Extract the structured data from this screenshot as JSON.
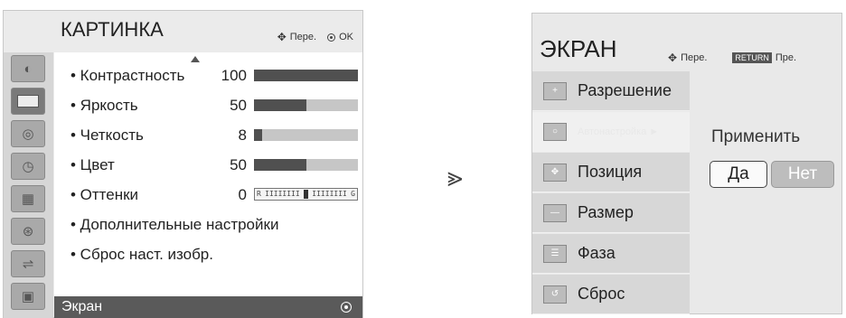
{
  "picture_menu": {
    "title": "КАРТИНКА",
    "hint_move": "Пере.",
    "hint_ok": "OK",
    "sidebar_icons": [
      "disc-icon",
      "screen-icon",
      "audio-icon",
      "clock-icon",
      "lock-icon",
      "option-icon",
      "input-icon",
      "usb-icon"
    ],
    "items": [
      {
        "label": "• Контрастность",
        "value": "100",
        "level": 1.0
      },
      {
        "label": "• Яркость",
        "value": "50",
        "level": 0.5
      },
      {
        "label": "• Четкость",
        "value": "8",
        "level": 0.08
      },
      {
        "label": "• Цвет",
        "value": "50",
        "level": 0.5
      },
      {
        "label": "• Оттенки",
        "value": "0",
        "tint_left": "R",
        "tint_right": "G"
      },
      {
        "label": "• Дополнительные настройки"
      },
      {
        "label": "• Сброс наст. изобр."
      }
    ],
    "footer": "Экран"
  },
  "transition_arrow": "⪢",
  "screen_menu": {
    "title": "ЭКРАН",
    "hint_move": "Пере.",
    "return_chip": "RETURN",
    "hint_back": "Пре.",
    "items": [
      {
        "label": "Разрешение",
        "icon": "plus-icon"
      },
      {
        "label": "Автонастройка ►",
        "icon": "auto-icon",
        "selected": true
      },
      {
        "label": "Позиция",
        "icon": "position-icon"
      },
      {
        "label": "Размер",
        "icon": "size-icon"
      },
      {
        "label": "Фаза",
        "icon": "phase-icon"
      },
      {
        "label": "Сброс",
        "icon": "reset-icon"
      }
    ],
    "apply_label": "Применить",
    "yes": "Да",
    "no": "Нет"
  }
}
